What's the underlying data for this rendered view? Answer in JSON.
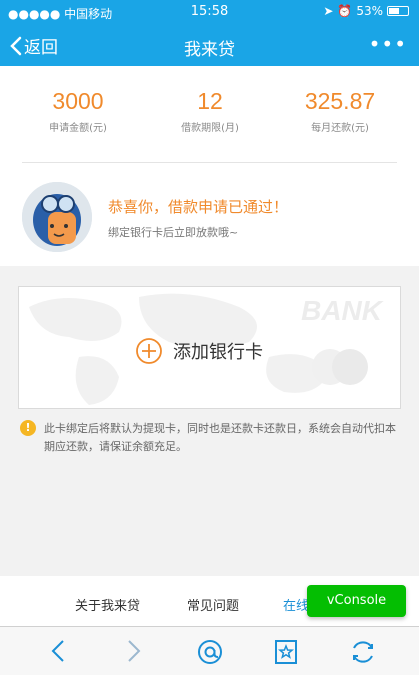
{
  "status_bar": {
    "carrier": "●●●●● 中国移动",
    "time": "15:58",
    "battery": "53%",
    "battery_level": 0.53
  },
  "nav": {
    "back_label": "返回",
    "title": "我来贷",
    "more_label": "•••"
  },
  "loan": {
    "amount": "3000",
    "amount_label": "申请金额(元)",
    "term": "12",
    "term_label": "借款期限(月)",
    "monthly": "325.87",
    "monthly_label": "每月还款(元)"
  },
  "approval": {
    "title": "恭喜你，借款申请已通过！",
    "subtitle": "绑定银行卡后立即放款哦~"
  },
  "bank_card": {
    "watermark": "BANK",
    "add_label": "添加银行卡"
  },
  "notice": {
    "icon": "warning-icon",
    "text": "此卡绑定后将默认为提现卡，同时也是还款卡还款日，系统会自动代扣本期应还款，请保证余额充足。"
  },
  "footer_links": {
    "about": "关于我来贷",
    "faq": "常见问题",
    "online": "在线"
  },
  "vconsole": {
    "label": "vConsole"
  },
  "colors": {
    "brand": "#1aa5e6",
    "accent": "#f08a2c",
    "vconsole": "#04be02"
  }
}
